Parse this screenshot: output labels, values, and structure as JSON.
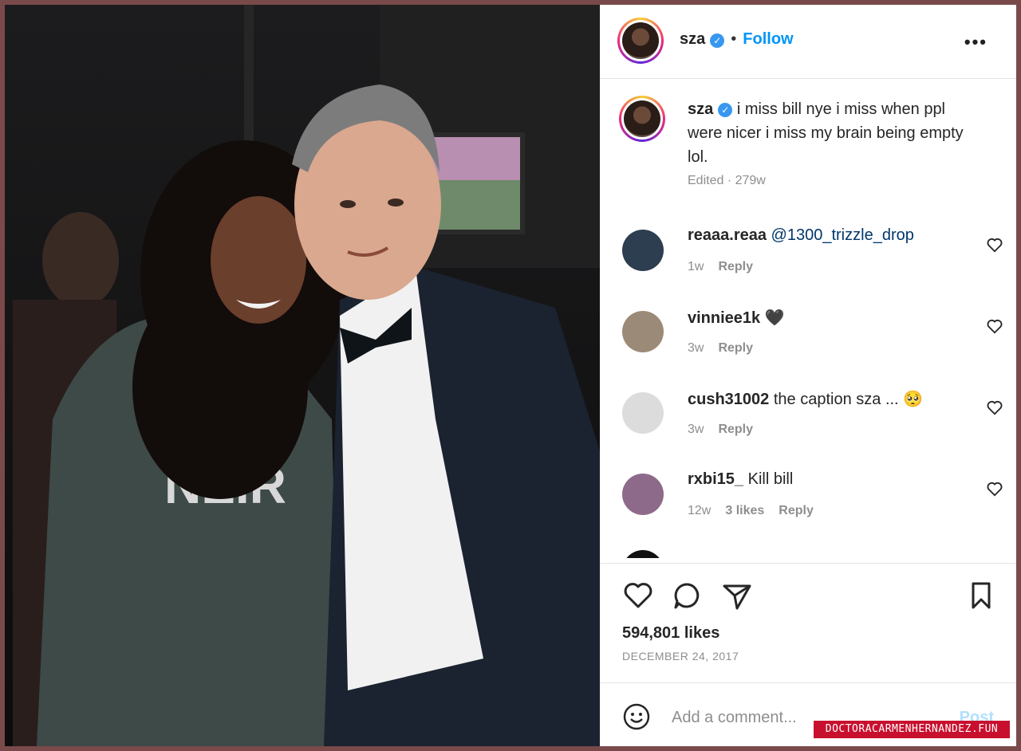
{
  "header": {
    "username": "sza",
    "separator": "•",
    "follow_label": "Follow",
    "more_label": "•••"
  },
  "caption": {
    "username": "sza",
    "text": "i miss bill nye i miss when ppl were nicer i miss my brain being empty lol.",
    "meta": "Edited · 279w"
  },
  "comments": [
    {
      "user": "reaaa.reaa",
      "mention": "@1300_trizzle_drop",
      "text": "",
      "time": "1w",
      "likes": "",
      "reply": "Reply",
      "avatar_color": "#2c3e50"
    },
    {
      "user": "vinniee1k",
      "mention": "",
      "text": "🖤",
      "time": "3w",
      "likes": "",
      "reply": "Reply",
      "avatar_color": "#9c8a78"
    },
    {
      "user": "cush31002",
      "mention": "",
      "text": "the caption sza ... 🥺",
      "time": "3w",
      "likes": "",
      "reply": "Reply",
      "avatar_color": "#dcdcdc"
    },
    {
      "user": "rxbi15_",
      "mention": "",
      "text": "Kill bill",
      "time": "12w",
      "likes": "3 likes",
      "reply": "Reply",
      "avatar_color": "#8e6a8a"
    }
  ],
  "actions": {
    "likes": "594,801 likes",
    "date": "DECEMBER 24, 2017"
  },
  "add_comment": {
    "placeholder": "Add a comment...",
    "post_label": "Post"
  },
  "watermark": "DOCTORACARMENHERNANDEZ.FUN",
  "colors": {
    "accent": "#0095f6",
    "verified": "#3897f0",
    "muted": "#8e8e8e"
  }
}
